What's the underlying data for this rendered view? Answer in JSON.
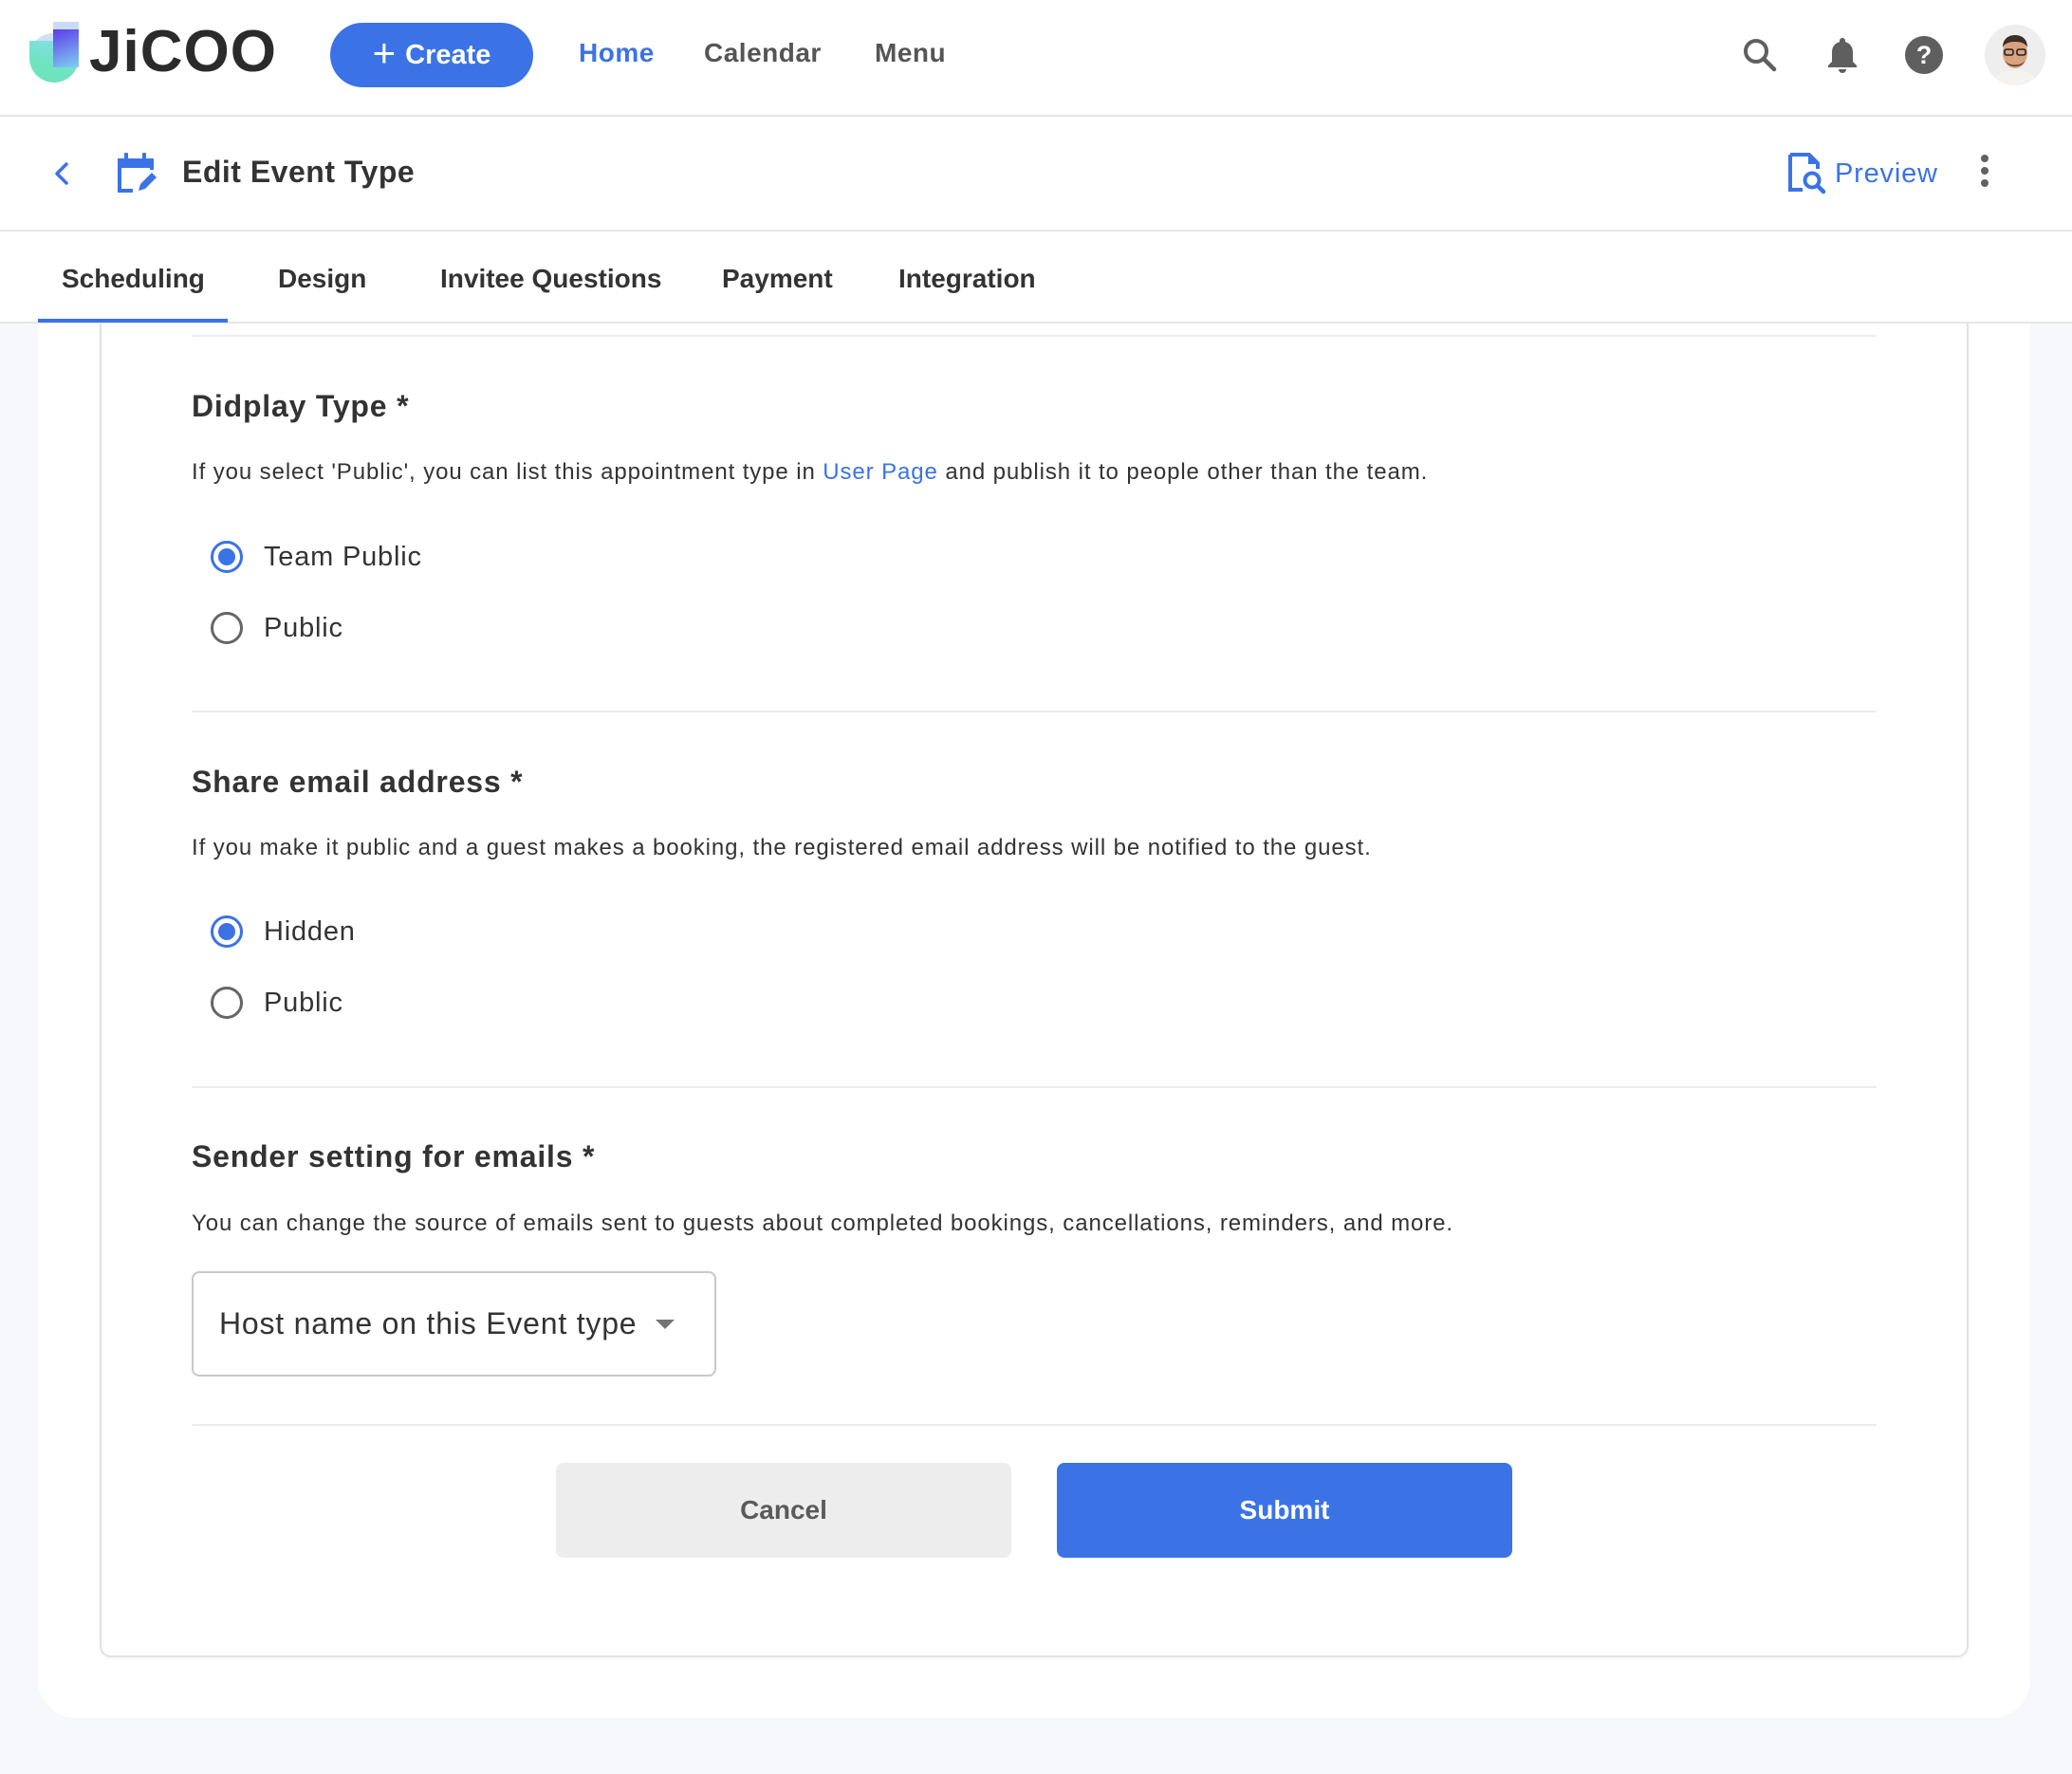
{
  "app": {
    "logo_text": "JiCOO",
    "brand_color": "#3B73E6"
  },
  "topbar": {
    "create_label": "Create",
    "nav": [
      {
        "label": "Home",
        "active": true
      },
      {
        "label": "Calendar",
        "active": false
      },
      {
        "label": "Menu",
        "active": false
      }
    ],
    "icons": [
      "search-icon",
      "bell-icon",
      "help-icon",
      "avatar"
    ]
  },
  "subheader": {
    "title": "Edit Event Type",
    "preview_label": "Preview"
  },
  "tabs": [
    {
      "label": "Scheduling",
      "active": true
    },
    {
      "label": "Design",
      "active": false
    },
    {
      "label": "Invitee Questions",
      "active": false
    },
    {
      "label": "Payment",
      "active": false
    },
    {
      "label": "Integration",
      "active": false
    }
  ],
  "sections": {
    "display_type": {
      "title": "Didplay Type *",
      "desc_before": "If you select 'Public', you can list this appointment type in ",
      "desc_link": "User Page",
      "desc_after": " and publish it to people other than the team.",
      "options": [
        {
          "label": "Team Public",
          "checked": true
        },
        {
          "label": "Public",
          "checked": false
        }
      ]
    },
    "share_email": {
      "title": "Share email address *",
      "desc": "If you make it public and a guest makes a booking, the registered email address will be notified to the guest.",
      "options": [
        {
          "label": "Hidden",
          "checked": true
        },
        {
          "label": "Public",
          "checked": false
        }
      ]
    },
    "sender_setting": {
      "title": "Sender setting for emails *",
      "desc": "You can change the source of emails sent to guests about completed bookings, cancellations, reminders, and more.",
      "selected": "Host name on this Event type"
    }
  },
  "actions": {
    "cancel_label": "Cancel",
    "submit_label": "Submit"
  }
}
